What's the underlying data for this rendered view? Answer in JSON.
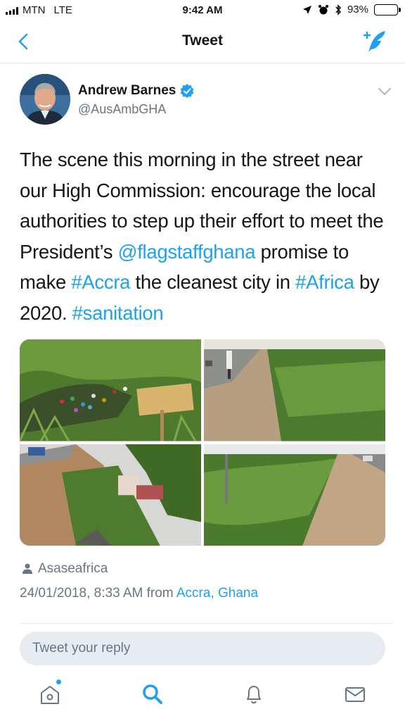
{
  "status_bar": {
    "carrier": "MTN",
    "network": "LTE",
    "time": "9:42 AM",
    "battery": "93%",
    "battery_level": 0.93
  },
  "nav": {
    "title": "Tweet"
  },
  "tweet": {
    "author_name": "Andrew Barnes",
    "handle": "@AusAmbGHA",
    "text_segments": [
      {
        "t": "The scene this morning in the street near our High Commission: encourage the local authorities to step up their effort to meet the President’s "
      },
      {
        "t": "@flagstaffghana"
      },
      {
        "t": " promise to make "
      },
      {
        "t": "#Accra"
      },
      {
        "t": " the cleanest city in "
      },
      {
        "t": "#Africa"
      },
      {
        "t": " by 2020. "
      },
      {
        "t": "#sanitation"
      }
    ],
    "location_tag": "Asaseafrica",
    "timestamp": "24/01/2018, 8:33 AM from",
    "place": "Accra, Ghana"
  },
  "reply": {
    "placeholder": "Tweet your reply"
  },
  "colors": {
    "accent": "#1da1f2",
    "muted": "#657786"
  }
}
